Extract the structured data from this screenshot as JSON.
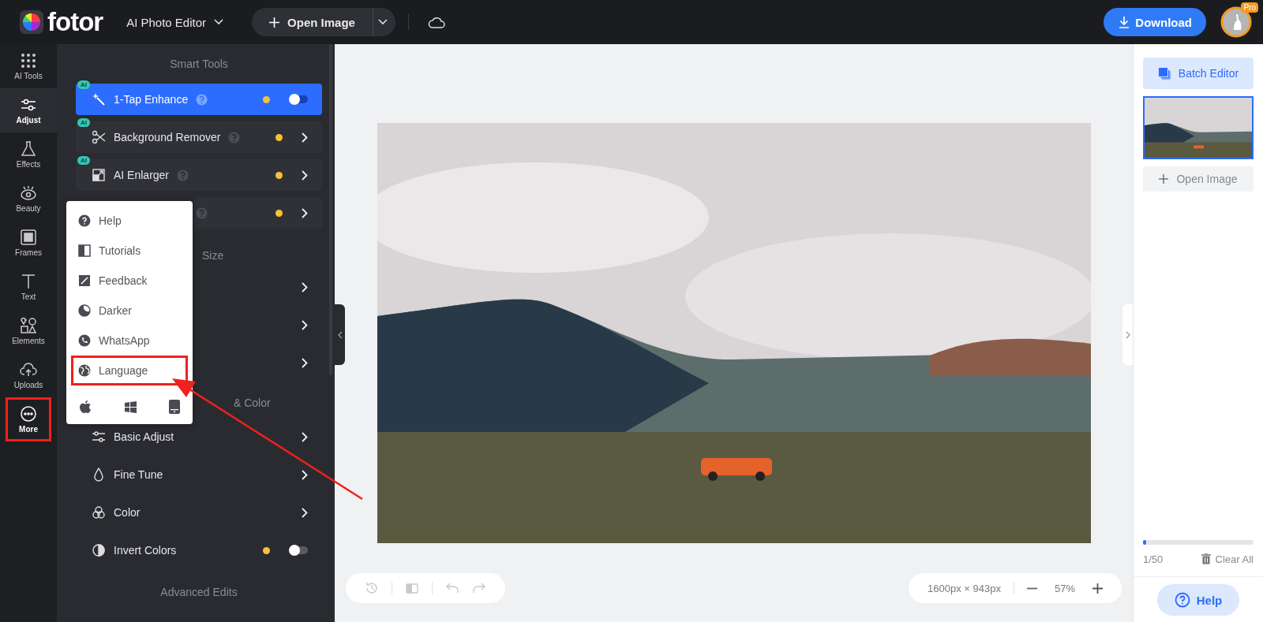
{
  "top_bar": {
    "logo_text": "fotor",
    "editor_menu": "AI Photo Editor",
    "open_image": "Open Image",
    "download": "Download",
    "avatar_badge": "Pro"
  },
  "rail": [
    {
      "label": "AI Tools",
      "selected": false,
      "highlighted": false
    },
    {
      "label": "Adjust",
      "selected": true,
      "highlighted": false
    },
    {
      "label": "Effects",
      "selected": false,
      "highlighted": false
    },
    {
      "label": "Beauty",
      "selected": false,
      "highlighted": false
    },
    {
      "label": "Frames",
      "selected": false,
      "highlighted": false
    },
    {
      "label": "Text",
      "selected": false,
      "highlighted": false
    },
    {
      "label": "Elements",
      "selected": false,
      "highlighted": false
    },
    {
      "label": "Uploads",
      "selected": false,
      "highlighted": false
    },
    {
      "label": "More",
      "selected": false,
      "highlighted": true
    }
  ],
  "panel": {
    "sections": [
      {
        "heading": "Smart Tools",
        "items": [
          {
            "label": "1-Tap Enhance",
            "badge": "AI",
            "help": true,
            "dot": true,
            "kind": "toggle",
            "on": false,
            "selected": true
          },
          {
            "label": "Background Remover",
            "badge": "AI",
            "help": true,
            "dot": true,
            "kind": "arrow",
            "selected": false
          },
          {
            "label": "AI Enlarger",
            "badge": "AI",
            "help": true,
            "dot": true,
            "kind": "arrow",
            "selected": false
          },
          {
            "help": true,
            "dot": true,
            "kind": "arrow",
            "selected": false
          }
        ]
      },
      {
        "heading": "Size",
        "items": [
          {
            "kind": "arrow",
            "selected": false
          },
          {
            "kind": "arrow",
            "selected": false
          },
          {
            "kind": "arrow",
            "selected": false
          }
        ]
      },
      {
        "heading": "& Color",
        "items": [
          {
            "label": "Basic Adjust",
            "kind": "arrow",
            "selected": false
          },
          {
            "label": "Fine Tune",
            "kind": "arrow",
            "selected": false
          },
          {
            "label": "Color",
            "kind": "arrow",
            "selected": false
          },
          {
            "label": "Invert Colors",
            "dot": true,
            "kind": "toggle",
            "on": false,
            "selected": false
          }
        ]
      },
      {
        "heading": "Advanced Edits"
      }
    ]
  },
  "more_menu": {
    "items": [
      {
        "label": "Help",
        "highlighted": false
      },
      {
        "label": "Tutorials",
        "highlighted": false
      },
      {
        "label": "Feedback",
        "highlighted": false
      },
      {
        "label": "Darker",
        "highlighted": false
      },
      {
        "label": "WhatsApp",
        "highlighted": false
      },
      {
        "label": "Language",
        "highlighted": true
      }
    ]
  },
  "canvas": {
    "image_size": "1600px × 943px",
    "zoom": "57%"
  },
  "right_panel": {
    "batch_editor": "Batch Editor",
    "thumbnail_selected": true,
    "open_image": "Open Image",
    "progress": {
      "level": 0.02
    },
    "count": "1/50",
    "clear_all": "Clear All",
    "help": "Help"
  }
}
